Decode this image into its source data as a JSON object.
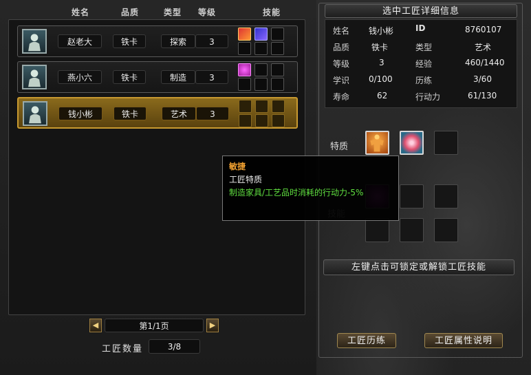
{
  "columns": {
    "name": "姓名",
    "quality": "品质",
    "type": "类型",
    "level": "等级",
    "skills": "技能"
  },
  "artisans": [
    {
      "name": "赵老大",
      "quality": "铁卡",
      "type": "探索",
      "level": "3",
      "selected": false
    },
    {
      "name": "燕小六",
      "quality": "铁卡",
      "type": "制造",
      "level": "3",
      "selected": false
    },
    {
      "name": "钱小彬",
      "quality": "铁卡",
      "type": "艺术",
      "level": "3",
      "selected": true
    }
  ],
  "pager": {
    "label": "第1/1页",
    "prev_icon": "arrow-left-icon",
    "next_icon": "arrow-right-icon"
  },
  "count": {
    "label": "工匠数量",
    "value": "3/8"
  },
  "details": {
    "title": "选中工匠详细信息",
    "rows": [
      {
        "l1": "姓名",
        "v1": "钱小彬",
        "l2": "ID",
        "v2": "8760107"
      },
      {
        "l1": "品质",
        "v1": "铁卡",
        "l2": "类型",
        "v2": "艺术"
      },
      {
        "l1": "等级",
        "v1": "3",
        "l2": "经验",
        "v2": "460/1440"
      },
      {
        "l1": "学识",
        "v1": "0/100",
        "l2": "历练",
        "v2": "3/60"
      },
      {
        "l1": "寿命",
        "v1": "62",
        "l2": "行动力",
        "v2": "61/130"
      }
    ]
  },
  "traits_label": "特质",
  "skills_label": "技能",
  "hint": "左键点击可锁定或解锁工匠技能",
  "buttons": {
    "training": "工匠历练",
    "attributes": "工匠属性说明"
  },
  "tooltip": {
    "name": "敏捷",
    "type": "工匠特质",
    "desc": "制造家具/工艺品时消耗的行动力-5%"
  },
  "colors": {
    "selected_row": "#8a6a1c",
    "tooltip_title": "#f0a030",
    "tooltip_desc": "#60e040"
  }
}
